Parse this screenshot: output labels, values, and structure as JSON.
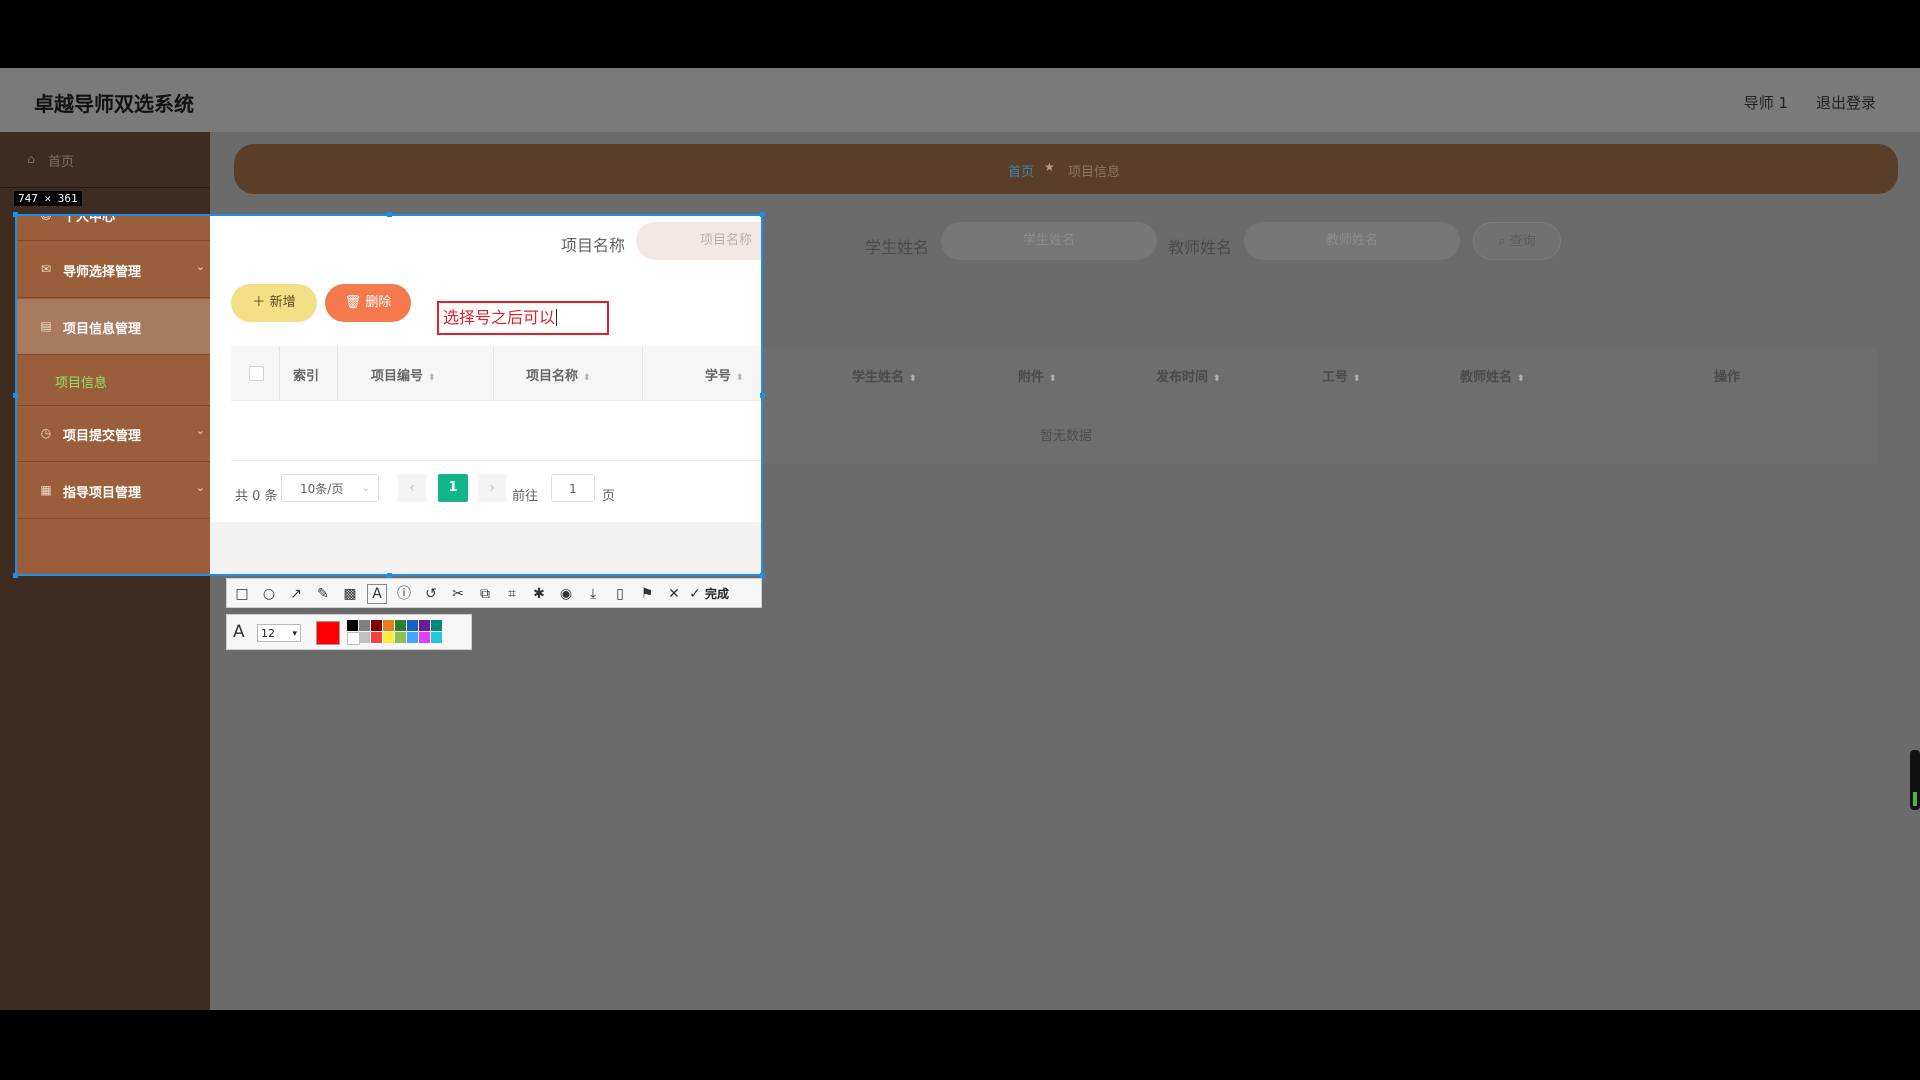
{
  "header": {
    "title": "卓越导师双选系统",
    "user": "导师 1",
    "logout": "退出登录"
  },
  "sidebar": {
    "items": [
      {
        "label": "首页",
        "icon": "home-icon"
      },
      {
        "label": "个人中心",
        "icon": "user-icon"
      },
      {
        "label": "导师选择管理",
        "icon": "mail-icon"
      },
      {
        "label": "项目信息管理",
        "icon": "folder-icon"
      },
      {
        "label": "项目信息",
        "icon": ""
      },
      {
        "label": "项目提交管理",
        "icon": "clock-icon"
      },
      {
        "label": "指导项目管理",
        "icon": "doc-icon"
      }
    ]
  },
  "breadcrumb": {
    "home": "首页",
    "current": "项目信息"
  },
  "search": {
    "project_name_label": "项目名称",
    "project_name_placeholder": "项目名称",
    "student_name_label": "学生姓名",
    "student_name_placeholder": "学生姓名",
    "teacher_name_label": "教师姓名",
    "teacher_name_placeholder": "教师姓名",
    "query_button": "查询"
  },
  "actions": {
    "add": "新增",
    "delete": "删除"
  },
  "annotation": {
    "text": "选择号之后可以",
    "color": "#e2222a"
  },
  "table": {
    "columns": [
      "索引",
      "项目编号",
      "项目名称",
      "学号",
      "学生姓名",
      "附件",
      "发布时间",
      "工号",
      "教师姓名",
      "操作"
    ],
    "empty_text": "暂无数据"
  },
  "pagination": {
    "total": "共 0 条",
    "page_size": "10条/页",
    "current_page": "1",
    "goto_label": "前往",
    "goto_value": "1",
    "page_suffix": "页"
  },
  "capture": {
    "size_label": "747 × 361",
    "done_label": "完成",
    "font_size": "12",
    "current_color": "#ff0000",
    "palette": [
      "#000000",
      "#808080",
      "#800000",
      "#e67e22",
      "#2e7d32",
      "#1565c0",
      "#6a1b9a",
      "#00897b",
      "#ffffff",
      "#c0c0c0",
      "#ef4444",
      "#ffeb3b",
      "#8bc34a",
      "#42a5f5",
      "#e040fb",
      "#26c6da"
    ],
    "tools": [
      "rect-tool-icon",
      "ellipse-tool-icon",
      "arrow-tool-icon",
      "pen-tool-icon",
      "mosaic-tool-icon",
      "text-tool-icon",
      "number-tool-icon",
      "undo-icon",
      "crop-icon",
      "translate-icon",
      "ocr-icon",
      "pin-icon",
      "record-icon",
      "download-icon",
      "long-capture-icon",
      "bookmark-icon",
      "close-icon"
    ]
  },
  "theme": {
    "sidebar_bright": "#9b5e3a",
    "accent_green": "#13b58a",
    "selection_blue": "#1e8fe6"
  }
}
